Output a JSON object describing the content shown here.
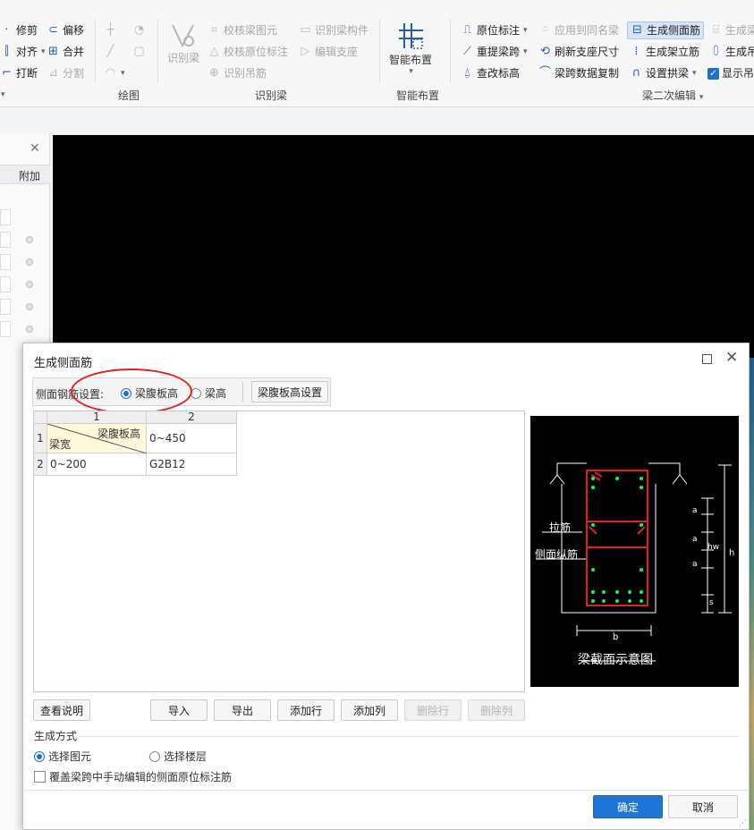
{
  "ribbon": {
    "edit": {
      "trim": "修剪",
      "offset": "偏移",
      "align": "对齐",
      "merge": "合并",
      "break": "打断",
      "split": "分割"
    },
    "draw": {
      "group": "绘图"
    },
    "identify_beam": {
      "big": "识别梁",
      "check_beam_element": "校核梁图元",
      "identify_beam_component": "识别梁构件",
      "check_origin_annotation": "校核原位标注",
      "edit_support": "编辑支座",
      "identify_hanger": "识别吊筋",
      "group": "识别梁"
    },
    "smart": {
      "big": "智能布置",
      "group": "智能布置"
    },
    "beam_edit": {
      "origin_annotation": "原位标注",
      "apply_same_name": "应用到同名梁",
      "gen_side_rebar": "生成侧面筋",
      "gen_more": "生成梁",
      "re_extract_span": "重提梁跨",
      "refresh_support": "刷新支座尺寸",
      "gen_stirrup_leg": "生成架立筋",
      "gen_hanger": "生成吊",
      "check_elevation": "查改标高",
      "span_copy": "梁跨数据复制",
      "set_arch_beam": "设置拱梁",
      "show": "显示吊",
      "group": "梁二次编辑"
    }
  },
  "left_panel": {
    "header": "附加"
  },
  "dialog": {
    "title": "生成侧面筋",
    "setting_label": "侧面钢筋设置:",
    "opt_web_height": "梁腹板高",
    "opt_beam_height": "梁高",
    "web_height_settings_button": "梁腹板高设置",
    "table": {
      "col_headers": [
        "1",
        "2"
      ],
      "row_headers": [
        "1",
        "2"
      ],
      "diag_top": "梁腹板高",
      "diag_bottom": "梁宽",
      "r1c2": "0~450",
      "r2c1": "0~200",
      "r2c2": "G2B12"
    },
    "schematic": {
      "tie_bar": "拉筋",
      "side_long_bar": "侧面纵筋",
      "label_a": "a",
      "label_hw": "hw",
      "label_h": "h",
      "label_s": "s",
      "label_b": "b",
      "caption": "梁截面示意图"
    },
    "buttons": {
      "view_desc": "查看说明",
      "import": "导入",
      "export": "导出",
      "add_row": "添加行",
      "add_col": "添加列",
      "delete_row": "删除行",
      "delete_col": "删除列"
    },
    "generation": {
      "label": "生成方式",
      "select_element": "选择图元",
      "select_floor": "选择楼层",
      "overwrite_label": "覆盖梁跨中手动编辑的侧面原位标注筋"
    },
    "ok": "确定",
    "cancel": "取消"
  }
}
